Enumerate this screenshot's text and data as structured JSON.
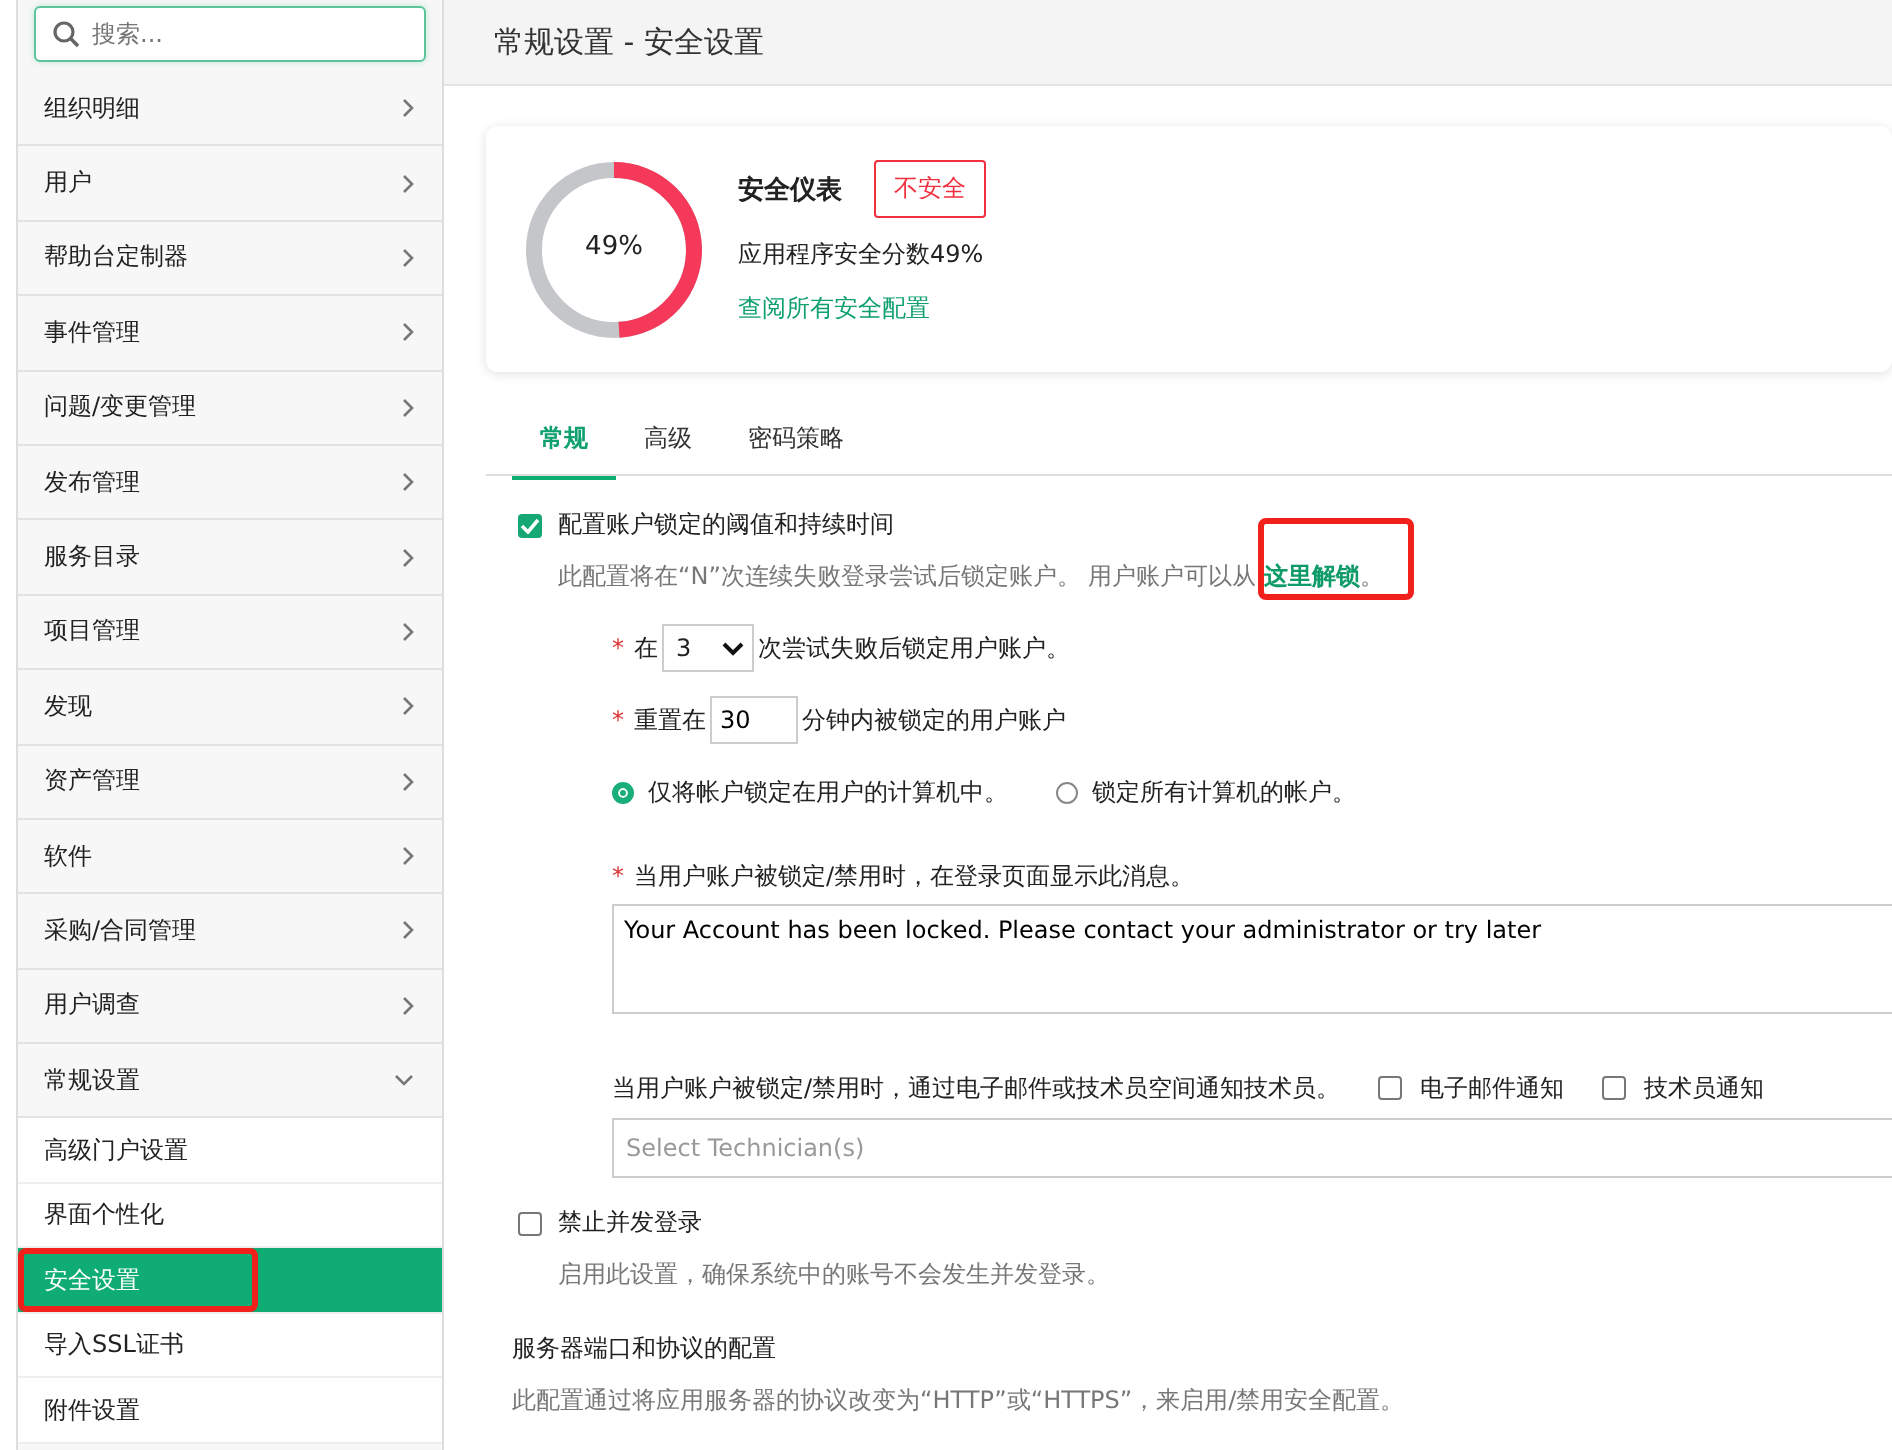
{
  "search": {
    "placeholder": "搜索..."
  },
  "sidebar": {
    "items": [
      {
        "label": "组织明细",
        "expanded": false
      },
      {
        "label": "用户",
        "expanded": false
      },
      {
        "label": "帮助台定制器",
        "expanded": false
      },
      {
        "label": "事件管理",
        "expanded": false
      },
      {
        "label": "问题/变更管理",
        "expanded": false
      },
      {
        "label": "发布管理",
        "expanded": false
      },
      {
        "label": "服务目录",
        "expanded": false
      },
      {
        "label": "项目管理",
        "expanded": false
      },
      {
        "label": "发现",
        "expanded": false
      },
      {
        "label": "资产管理",
        "expanded": false
      },
      {
        "label": "软件",
        "expanded": false
      },
      {
        "label": "采购/合同管理",
        "expanded": false
      },
      {
        "label": "用户调查",
        "expanded": false
      },
      {
        "label": "常规设置",
        "expanded": true,
        "children": [
          {
            "label": "高级门户设置",
            "selected": false,
            "highlighted": false
          },
          {
            "label": "界面个性化",
            "selected": false,
            "highlighted": false
          },
          {
            "label": "安全设置",
            "selected": true,
            "highlighted": true
          },
          {
            "label": "导入SSL证书",
            "selected": false,
            "highlighted": false
          },
          {
            "label": "附件设置",
            "selected": false,
            "highlighted": false
          }
        ]
      }
    ]
  },
  "page_title": "常规设置 - 安全设置",
  "gauge": {
    "level": 0.49,
    "reading": "49%",
    "title": "安全仪表",
    "badge": "不安全",
    "score_text": "应用程序安全分数49%",
    "link": "查阅所有安全配置"
  },
  "tabs": [
    {
      "label": "常规",
      "selected": true
    },
    {
      "label": "高级",
      "selected": false
    },
    {
      "label": "密码策略",
      "selected": false
    }
  ],
  "lockout": {
    "checked": true,
    "label": "配置账户锁定的阈值和持续时间",
    "description": "此配置将在“N”次连续失败登录尝试后锁定账户。 用户账户可以从",
    "link": "这里解锁",
    "link_highlighted": true,
    "link_suffix": "。",
    "attempts": {
      "required_mark": "*",
      "prefix": "在",
      "value": "3",
      "suffix": "次尝试失败后锁定用户账户。"
    },
    "reset": {
      "required_mark": "*",
      "prefix": "重置在",
      "value": "30",
      "suffix": "分钟内被锁定的用户账户"
    },
    "scope": [
      {
        "label": "仅将帐户锁定在用户的计算机中。",
        "selected": true
      },
      {
        "label": "锁定所有计算机的帐户。",
        "selected": false
      }
    ],
    "message_required_mark": "*",
    "message_label": "当用户账户被锁定/禁用时，在登录页面显示此消息。",
    "message": "Your Account has been locked. Please contact your administrator or try later",
    "notify_label": "当用户账户被锁定/禁用时，通过电子邮件或技术员空间通知技术员。",
    "notify_options": [
      {
        "label": "电子邮件通知",
        "checked": false
      },
      {
        "label": "技术员通知",
        "checked": false
      }
    ],
    "technician_placeholder": "Select Technician(s)"
  },
  "concurrent": {
    "checked": false,
    "label": "禁止并发登录",
    "description": "启用此设置，确保系统中的账号不会发生并发登录。"
  },
  "server": {
    "title": "服务器端口和协议的配置",
    "description": "此配置通过将应用服务器的协议改变为“HTTP”或“HTTPS”，来启用/禁用安全配置。"
  }
}
